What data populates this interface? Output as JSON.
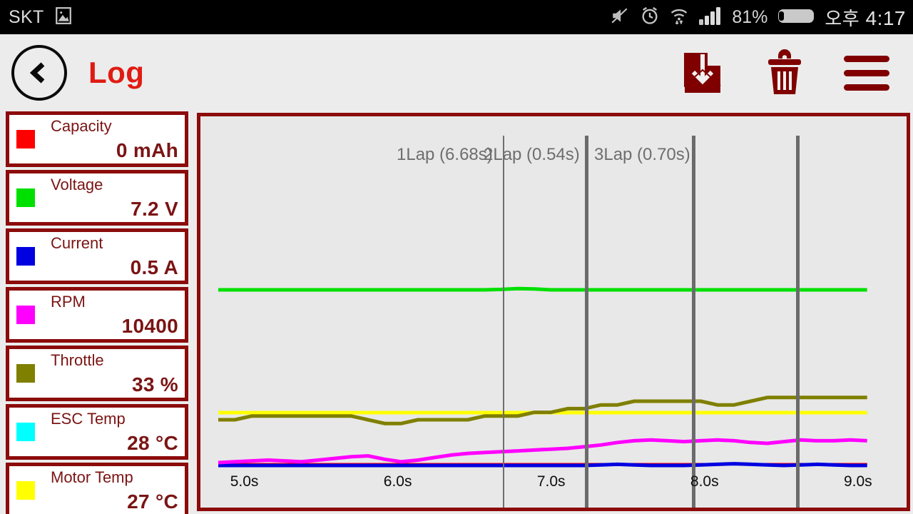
{
  "status_bar": {
    "carrier": "SKT",
    "image_icon": "image-icon",
    "mute_icon": "mute-icon",
    "alarm_icon": "alarm-clock-icon",
    "wifi_icon": "wifi-icon",
    "signal_icon": "signal-bars-icon",
    "battery_percent": "81%",
    "battery_icon": "battery-icon",
    "ampm": "오후",
    "time": "4:17"
  },
  "action_bar": {
    "back_label": "back",
    "title": "Log",
    "save_icon": "save-download-icon",
    "delete_icon": "trash-icon",
    "menu_icon": "hamburger-menu-icon"
  },
  "sidebar": {
    "cards": [
      {
        "label": "Capacity",
        "value": "0 mAh",
        "color": "#ff0000"
      },
      {
        "label": "Voltage",
        "value": "7.2 V",
        "color": "#00e000"
      },
      {
        "label": "Current",
        "value": "0.5 A",
        "color": "#0000e0"
      },
      {
        "label": "RPM",
        "value": "10400",
        "color": "#ff00ff"
      },
      {
        "label": "Throttle",
        "value": "33 %",
        "color": "#7f7f00"
      },
      {
        "label": "ESC Temp",
        "value": "28 °C",
        "color": "#00ffff"
      },
      {
        "label": "Motor Temp",
        "value": "27 °C",
        "color": "#ffff00"
      }
    ]
  },
  "chart_data": {
    "type": "line",
    "title": "",
    "xlabel": "",
    "ylabel": "",
    "xlim": [
      4.82,
      9.2
    ],
    "x_ticks": [
      "5.0s",
      "6.0s",
      "7.0s",
      "8.0s",
      "9.0s"
    ],
    "x_tick_values": [
      5.0,
      6.0,
      7.0,
      8.0,
      9.0
    ],
    "grid": false,
    "legend": "sidebar-cards",
    "annotations": [
      {
        "label": "1Lap (6.68s)",
        "x": 6.68,
        "style": "thin"
      },
      {
        "label": "2Lap (0.54s)",
        "x": 7.22,
        "style": "thick"
      },
      {
        "label": "3Lap (0.70s)",
        "x": 7.92,
        "style": "thick"
      },
      {
        "label": "",
        "x": 8.6,
        "style": "thick"
      }
    ],
    "series": [
      {
        "name": "Capacity",
        "color": "#ff0000",
        "unit": "mAh",
        "values": [
          0,
          0,
          0,
          0,
          0,
          0,
          0,
          0,
          0,
          0,
          0,
          0,
          0,
          0,
          0,
          0,
          0,
          0,
          0,
          0,
          0,
          0,
          0,
          0,
          0,
          0,
          0,
          0,
          0,
          0,
          0,
          0,
          0,
          0,
          0,
          0,
          0,
          0,
          0,
          0
        ]
      },
      {
        "name": "Voltage",
        "color": "#00e000",
        "unit": "V",
        "values": [
          7.2,
          7.2,
          7.2,
          7.2,
          7.2,
          7.2,
          7.2,
          7.2,
          7.2,
          7.2,
          7.2,
          7.2,
          7.2,
          7.2,
          7.2,
          7.2,
          7.2,
          7.21,
          7.23,
          7.22,
          7.2,
          7.2,
          7.2,
          7.2,
          7.2,
          7.2,
          7.2,
          7.2,
          7.2,
          7.2,
          7.2,
          7.2,
          7.2,
          7.2,
          7.2,
          7.2,
          7.2,
          7.2,
          7.2,
          7.2
        ]
      },
      {
        "name": "Current",
        "color": "#0000e0",
        "unit": "A",
        "values": [
          0.5,
          0.5,
          0.5,
          0.5,
          0.5,
          0.5,
          0.5,
          0.5,
          0.5,
          0.5,
          0.5,
          0.5,
          0.5,
          0.5,
          0.5,
          0.5,
          0.5,
          0.5,
          0.5,
          0.5,
          0.5,
          0.5,
          0.5,
          0.6,
          0.7,
          0.6,
          0.5,
          0.5,
          0.5,
          0.6,
          0.7,
          0.8,
          0.7,
          0.6,
          0.5,
          0.6,
          0.7,
          0.6,
          0.5,
          0.5
        ]
      },
      {
        "name": "RPM",
        "color": "#ff00ff",
        "unit": "rpm",
        "values": [
          9100,
          9150,
          9200,
          9250,
          9200,
          9150,
          9250,
          9350,
          9450,
          9500,
          9300,
          9150,
          9250,
          9400,
          9550,
          9650,
          9700,
          9750,
          9800,
          9850,
          9900,
          9950,
          10050,
          10150,
          10300,
          10400,
          10450,
          10400,
          10350,
          10400,
          10450,
          10400,
          10300,
          10250,
          10350,
          10450,
          10400,
          10400,
          10450,
          10400
        ]
      },
      {
        "name": "Throttle",
        "color": "#7f7f00",
        "unit": "%",
        "values": [
          28,
          28,
          29,
          29,
          29,
          29,
          29,
          29,
          29,
          28,
          27,
          27,
          28,
          28,
          28,
          28,
          29,
          29,
          29,
          30,
          30,
          31,
          31,
          32,
          32,
          33,
          33,
          33,
          33,
          33,
          32,
          32,
          33,
          34,
          34,
          34,
          34,
          34,
          34,
          34
        ]
      },
      {
        "name": "ESC Temp",
        "color": "#00ffff",
        "unit": "°C",
        "values": [
          28,
          28,
          28,
          28,
          28,
          28,
          28,
          28,
          28,
          28,
          28,
          28,
          28,
          28,
          28,
          28,
          28,
          28,
          28,
          28,
          28,
          28,
          28,
          28,
          28,
          28,
          28,
          28,
          28,
          28,
          28,
          28,
          28,
          28,
          28,
          28,
          28,
          28,
          28,
          28
        ]
      },
      {
        "name": "Motor Temp",
        "color": "#ffff00",
        "unit": "°C",
        "values": [
          27,
          27,
          27,
          27,
          27,
          27,
          27,
          27,
          27,
          27,
          27,
          27,
          27,
          27,
          27,
          27,
          27,
          27,
          27,
          27,
          27,
          27,
          27,
          27,
          27,
          27,
          27,
          27,
          27,
          27,
          27,
          27,
          27,
          27,
          27,
          27,
          27,
          27,
          27,
          27
        ]
      }
    ]
  }
}
